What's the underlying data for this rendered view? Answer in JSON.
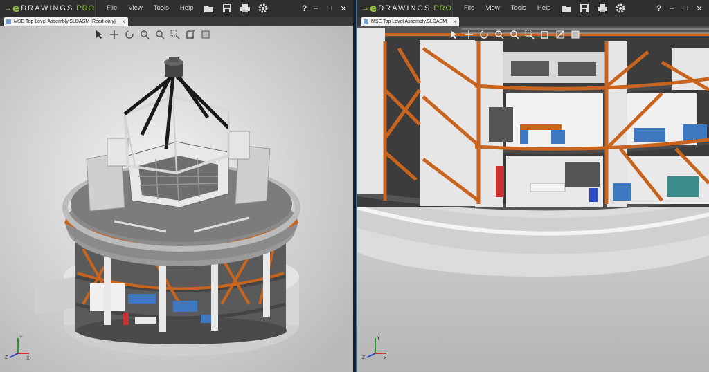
{
  "app": {
    "logo_mark": "e",
    "logo_text": "DRAWINGS",
    "logo_pro": "PRO"
  },
  "menu": [
    "File",
    "View",
    "Tools",
    "Help"
  ],
  "toolbar_icons": [
    "open-icon",
    "save-icon",
    "print-icon",
    "gear-icon"
  ],
  "help_label": "?",
  "window_controls": {
    "minimize": "–",
    "maximize": "□",
    "close": "✕"
  },
  "left_window": {
    "tab_label": "MSE Top Level Assembly.SLDASM [Read-only]",
    "view_tools": [
      "select-arrow-icon",
      "pan-icon",
      "rotate-icon",
      "zoom-icon",
      "zoom-fit-icon",
      "zoom-area-icon",
      "standard-views-icon",
      "display-style-icon"
    ]
  },
  "right_window": {
    "tab_label": "MSE Top Level Assembly.SLDASM",
    "view_tools": [
      "select-arrow-icon",
      "pan-icon",
      "rotate-icon",
      "zoom-icon",
      "zoom-fit-icon",
      "zoom-area-icon",
      "standard-views-icon",
      "section-icon",
      "display-style-icon"
    ]
  },
  "triad_labels": {
    "x": "X",
    "y": "Y",
    "z": "Z"
  },
  "colors": {
    "accent": "#8cc63f",
    "titlebar": "#2f2f2f",
    "steel": "#c8641e",
    "highlight": "#3a6fb0"
  }
}
